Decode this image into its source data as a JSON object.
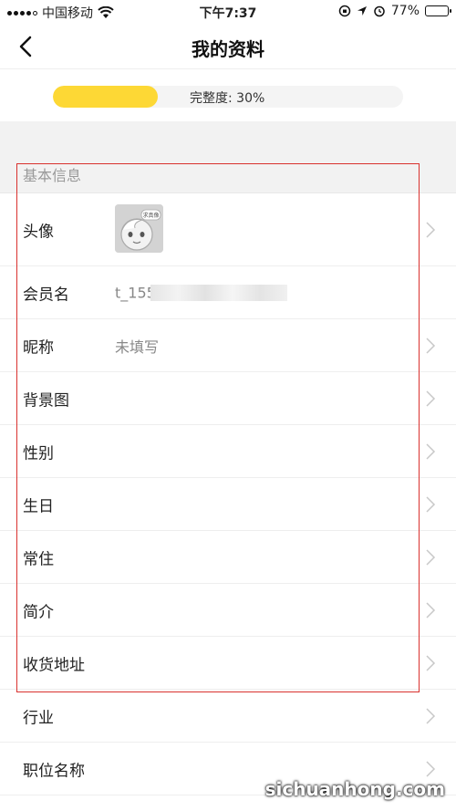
{
  "status_bar": {
    "carrier": "中国移动",
    "time": "下午7:37",
    "battery_percent": "77%",
    "battery_level": 0.77
  },
  "nav": {
    "title": "我的资料"
  },
  "profile": {
    "progress_label": "完整度: 30%",
    "progress_fraction": 0.3,
    "progress_color": "#fdd835"
  },
  "section": {
    "title": "基本信息"
  },
  "rows": [
    {
      "label": "头像"
    },
    {
      "label": "会员名",
      "value": "t_155"
    },
    {
      "label": "昵称",
      "value": "未填写"
    },
    {
      "label": "背景图"
    },
    {
      "label": "性别"
    },
    {
      "label": "生日"
    },
    {
      "label": "常住"
    },
    {
      "label": "简介"
    },
    {
      "label": "收货地址"
    },
    {
      "label": "行业"
    },
    {
      "label": "职位名称"
    }
  ],
  "avatar_badge": "求真像",
  "watermark": "sichuanhong.com",
  "highlight_color": "#d9312e"
}
